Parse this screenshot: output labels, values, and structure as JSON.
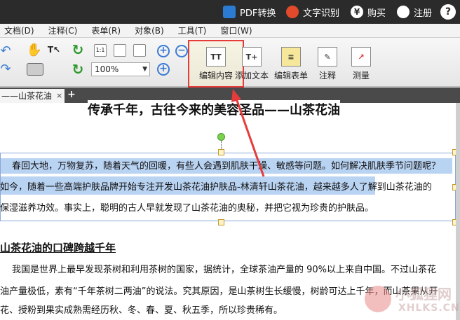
{
  "titlebar": {
    "pdf_convert": "PDF转换",
    "ocr_icon": "OCR",
    "text_recognition": "文字识别",
    "buy": "购买",
    "register": "注册",
    "help": "?"
  },
  "menu": [
    "文档(D)",
    "注释(C)",
    "表单(R)",
    "对象(B)",
    "工具(T)",
    "窗口(W)"
  ],
  "toolbar": {
    "zoom_value": "100%",
    "zoom_icon_label": "1:1",
    "edit_content": "编辑内容",
    "add_text": "添加文本",
    "edit_form": "编辑表单",
    "annotate": "注释",
    "measure": "测量"
  },
  "tabs": {
    "doc_tab": "——山茶花油",
    "close": "×",
    "new_tab": "+"
  },
  "document": {
    "heading": "传承千年，古往今来的美容圣品——山茶花油",
    "para1_line1": "春回大地，万物复苏，随着天气的回暖，有些人会遇到肌肤干燥、敏感等问题。如何解决肌肤季节问题呢？",
    "para1_line2": "如今，随着一些高端护肤品牌开始专注开发山茶花油护肤品-林清轩山茶花油，越来越多人了解到山茶花油的",
    "para1_line3": "保湿滋养功效。事实上，聪明的古人早就发现了山茶花油的奥秘，并把它视为珍贵的护肤品。",
    "subheading": "山茶花油的口碑跨越千年",
    "para2_line1": "我国是世界上最早发现茶树和利用茶树的国家，据统计，全球茶油产量的 90%以上来自中国。不过山茶花",
    "para2_line2": "油产量极低，素有“千年茶树二两油”的说法。究其原因，是山茶树生长缓慢，树龄可达上千年，而山茶果从开",
    "para2_line3": "花、授粉到果实成熟需经历秋、冬、春、夏、秋五季，所以珍贵稀有。"
  },
  "watermark": {
    "cn": "小狐狸网",
    "en": "XHLKS.CN"
  },
  "colors": {
    "annotation_red": "#e63b3b",
    "selection_blue": "#b9d3f2",
    "titlebar_dark": "#2b2b2b"
  }
}
